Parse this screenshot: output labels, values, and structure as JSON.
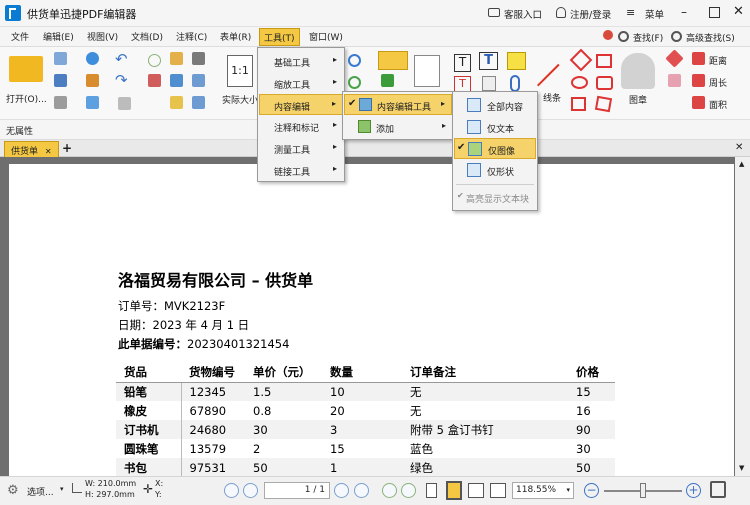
{
  "titlebar": {
    "title": "供货单迅捷PDF编辑器",
    "service": "客服入口",
    "login": "注册/登录",
    "menu": "菜单"
  },
  "menubar": [
    "文件",
    "编辑(E)",
    "视图(V)",
    "文档(D)",
    "注释(C)",
    "表单(R)",
    "工具(T)",
    "窗口(W)"
  ],
  "toolbar": {
    "open": "打开(O)...",
    "actual_size": "实际大小",
    "lines": "线条",
    "stamp": "图章",
    "find": "查找(F)",
    "advanced_find": "高级查找(S)",
    "distance": "距离",
    "perimeter": "周长",
    "area": "面积"
  },
  "propbar": {
    "text": "无属性"
  },
  "tab": {
    "label": "供货单"
  },
  "tools_menu": [
    {
      "label": "基础工具"
    },
    {
      "label": "缩放工具"
    },
    {
      "label": "内容编辑"
    },
    {
      "label": "注释和标记"
    },
    {
      "label": "测量工具"
    },
    {
      "label": "链接工具"
    }
  ],
  "content_edit_menu": [
    {
      "label": "内容编辑工具"
    },
    {
      "label": "添加"
    }
  ],
  "edit_tool_menu": [
    {
      "label": "全部内容"
    },
    {
      "label": "仅文本"
    },
    {
      "label": "仅图像"
    },
    {
      "label": "仅形状"
    },
    {
      "label": "高亮显示文本块"
    }
  ],
  "document": {
    "title": "洛福贸易有限公司 – 供货单",
    "order_no": "订单号：MVK2123F",
    "date": "日期：2023 年 4 月 1 日",
    "doc_no_label": "此单据编号：",
    "doc_no": "20230401321454",
    "columns": [
      "货品",
      "货物编号",
      "单价（元）",
      "数量",
      "订单备注",
      "价格"
    ],
    "rows": [
      [
        "铅笔",
        "12345",
        "1.5",
        "10",
        "无",
        "15"
      ],
      [
        "橡皮",
        "67890",
        "0.8",
        "20",
        "无",
        "16"
      ],
      [
        "订书机",
        "24680",
        "30",
        "3",
        "附带 5 盒订书钉",
        "90"
      ],
      [
        "圆珠笔",
        "13579",
        "2",
        "15",
        "蓝色",
        "30"
      ],
      [
        "书包",
        "97531",
        "50",
        "1",
        "绿色",
        "50"
      ]
    ]
  },
  "statusbar": {
    "select": "选项...",
    "width": "W: 210.0mm",
    "height": "H: 297.0mm",
    "x": "X:",
    "y": "Y:",
    "page": "1 / 1",
    "zoom": "118.55%"
  },
  "colors": {
    "accent": "#f4c842",
    "highlight": "#f6d36a",
    "workspace": "#6f6f6f"
  }
}
